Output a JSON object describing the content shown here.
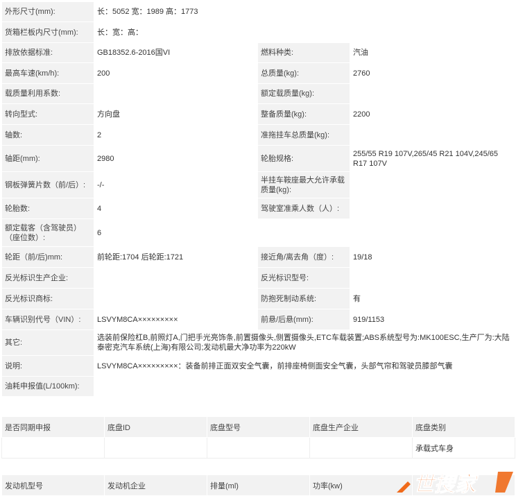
{
  "spec": {
    "dimensions": {
      "label": "外形尺寸(mm):",
      "value": "长：5052 宽：1989 高：1773"
    },
    "cargo_box": {
      "label": "货箱栏板内尺寸(mm):",
      "value": "长：宽：高："
    },
    "emission": {
      "label": "排放依据标准:",
      "value": "GB18352.6-2016国VI"
    },
    "fuel": {
      "label": "燃料种类:",
      "value": "汽油"
    },
    "max_speed": {
      "label": "最高车速(km/h):",
      "value": "200"
    },
    "gross_mass": {
      "label": "总质量(kg):",
      "value": "2760"
    },
    "load_util": {
      "label": "载质量利用系数:",
      "value": ""
    },
    "rated_load": {
      "label": "额定载质量(kg):",
      "value": ""
    },
    "steering": {
      "label": "转向型式:",
      "value": "方向盘"
    },
    "curb_mass": {
      "label": "整备质量(kg):",
      "value": "2200"
    },
    "axles": {
      "label": "轴数:",
      "value": "2"
    },
    "trailer_mass": {
      "label": "准拖挂车总质量(kg):",
      "value": ""
    },
    "wheelbase": {
      "label": "轴距(mm):",
      "value": "2980"
    },
    "tire": {
      "label": "轮胎规格:",
      "value": "255/55 R19 107V,265/45 R21 104V,245/65 R17 107V"
    },
    "leaf_spring": {
      "label": "钢板弹簧片数（前/后）:",
      "value": "-/-"
    },
    "saddle": {
      "label": "半挂车鞍座最大允许承载质量(kg):",
      "value": ""
    },
    "tires_count": {
      "label": "轮胎数:",
      "value": "4"
    },
    "cab_passengers": {
      "label": "驾驶室准乘人数（人）:",
      "value": ""
    },
    "seats": {
      "label": "额定载客（含驾驶员）（座位数）:",
      "value": "6"
    },
    "track": {
      "label": "轮距（前/后)mm:",
      "value": "前轮距:1704 后轮距:1721"
    },
    "angles": {
      "label": "接近角/离去角（度）:",
      "value": "19/18"
    },
    "reflector_maker": {
      "label": "反光标识生产企业:",
      "value": ""
    },
    "reflector_model": {
      "label": "反光标识型号:",
      "value": ""
    },
    "reflector_brand": {
      "label": "反光标识商标:",
      "value": ""
    },
    "abs": {
      "label": "防抱死制动系统:",
      "value": "有"
    },
    "vin": {
      "label": "车辆识别代号（VIN）:",
      "value": "LSVYM8CA×××××××××"
    },
    "overhang": {
      "label": "前悬/后悬(mm):",
      "value": "919/1153"
    },
    "other": {
      "label": "其它:",
      "value": "选装前保险杠B,前照灯A,门把手光亮饰条,前置摄像头,侧置摄像头,ETC车载装置;ABS系统型号为:MK100ESC,生产厂为:大陆泰密克汽车系统(上海)有限公司;发动机最大净功率为220kW"
    },
    "note": {
      "label": "说明:",
      "value": "LSVYM8CA×××××××××：装备前排正面双安全气囊，前排座椅侧面安全气囊，头部气帘和驾驶员膝部气囊"
    },
    "fuel_consumption": {
      "label": "油耗申报值(L/100km):",
      "value": ""
    }
  },
  "chassis": {
    "headers": [
      "是否同期申报",
      "底盘ID",
      "底盘型号",
      "底盘生产企业",
      "底盘类别"
    ],
    "row": [
      "",
      "",
      "",
      "",
      "承载式车身"
    ]
  },
  "engine": {
    "headers": [
      "发动机型号",
      "发动机企业",
      "排量(ml)",
      "功率(kw)",
      ""
    ]
  },
  "watermark": {
    "text": "世搜家",
    "color": "#f06a1a"
  }
}
